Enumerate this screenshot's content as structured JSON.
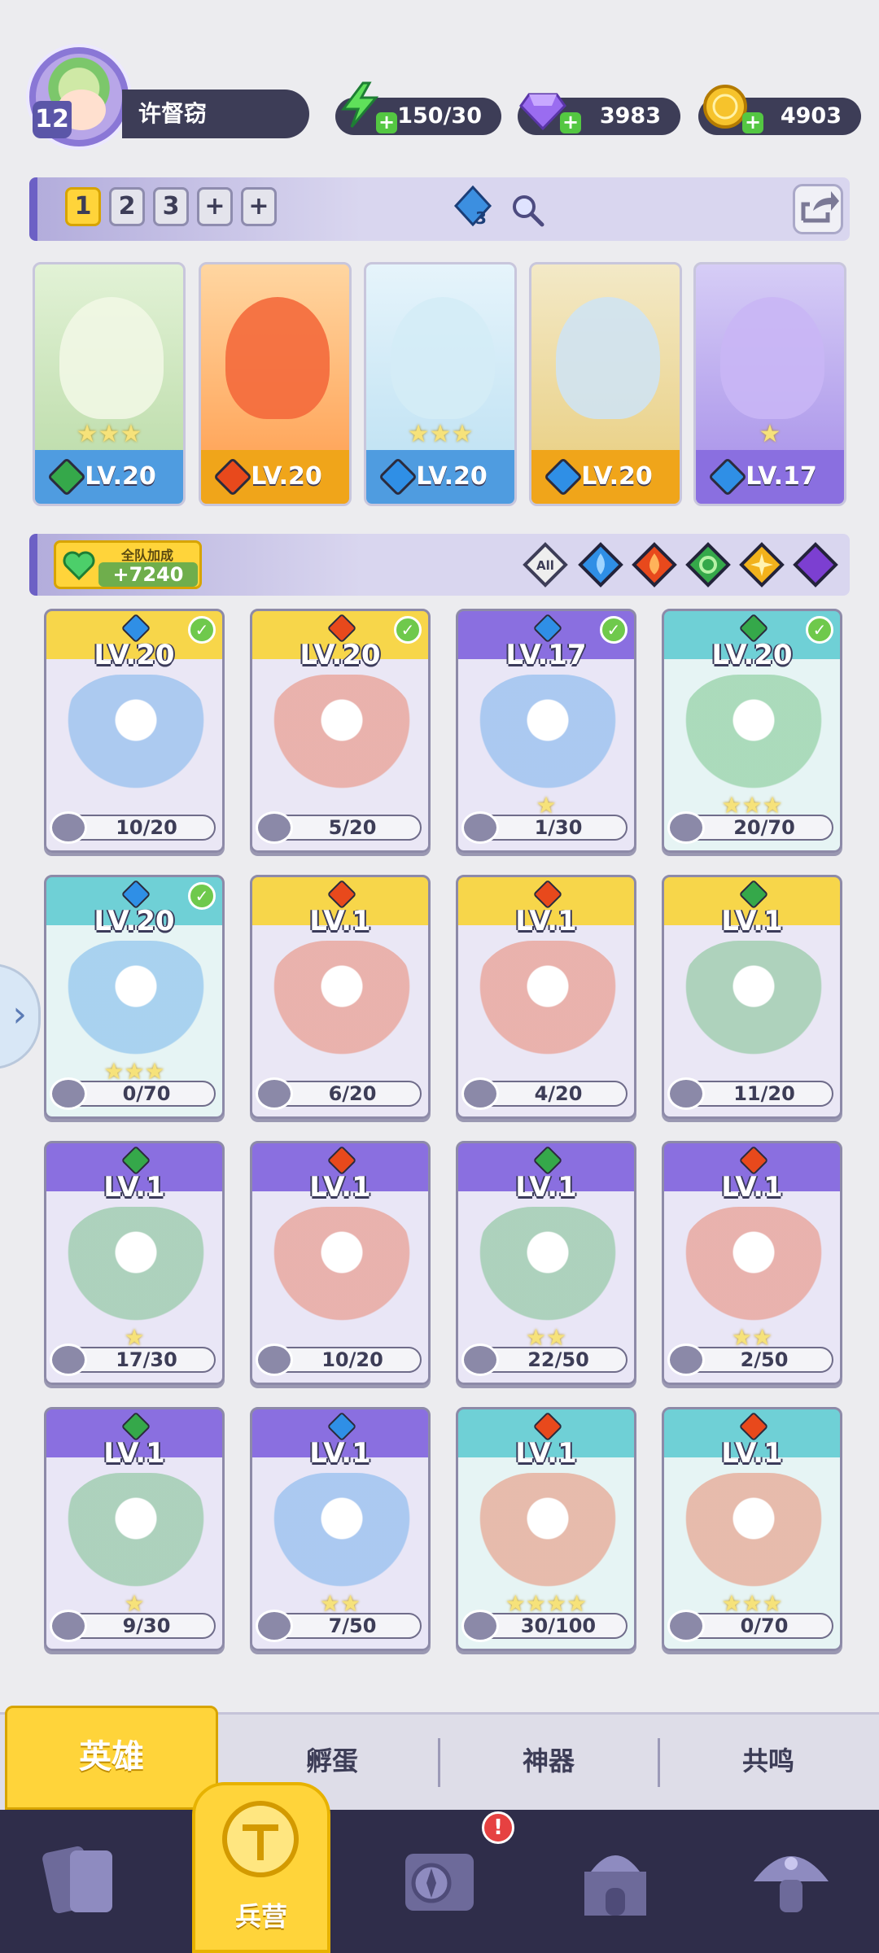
{
  "player": {
    "level": "12",
    "name": "许督窃"
  },
  "resources": [
    {
      "name": "energy",
      "value": "150/30",
      "icon": "lightning-icon"
    },
    {
      "name": "gems",
      "value": "3983",
      "icon": "diamond-icon"
    },
    {
      "name": "coins",
      "value": "4903",
      "icon": "coin-icon"
    }
  ],
  "team_slots": [
    "1",
    "2",
    "3",
    "+",
    "+"
  ],
  "team_gem_count": "3",
  "team": [
    {
      "level": "LV.20",
      "element": "nature",
      "stars": "★★★"
    },
    {
      "level": "LV.20",
      "element": "fire",
      "stars": ""
    },
    {
      "level": "LV.20",
      "element": "water",
      "stars": "★★★"
    },
    {
      "level": "LV.20",
      "element": "water",
      "stars": ""
    },
    {
      "level": "LV.17",
      "element": "water",
      "stars": "★"
    }
  ],
  "bonus": {
    "label": "全队加成",
    "value": "+7240"
  },
  "filters": [
    "All",
    "water",
    "fire",
    "nature",
    "light",
    "dark"
  ],
  "heroes": [
    {
      "level": "LV.20",
      "element": "water",
      "progress": "10/20",
      "stars": "",
      "owned": true,
      "bg": "gold"
    },
    {
      "level": "LV.20",
      "element": "fire",
      "progress": "5/20",
      "stars": "",
      "owned": true,
      "bg": "gold"
    },
    {
      "level": "LV.17",
      "element": "water",
      "progress": "1/30",
      "stars": "★",
      "owned": true,
      "bg": "purple"
    },
    {
      "level": "LV.20",
      "element": "nature",
      "progress": "20/70",
      "stars": "★★★",
      "owned": true,
      "bg": "teal"
    },
    {
      "level": "LV.20",
      "element": "water",
      "progress": "0/70",
      "stars": "★★★",
      "owned": true,
      "bg": "teal"
    },
    {
      "level": "LV.1",
      "element": "fire",
      "progress": "6/20",
      "stars": "",
      "owned": false,
      "bg": "gold"
    },
    {
      "level": "LV.1",
      "element": "fire",
      "progress": "4/20",
      "stars": "",
      "owned": false,
      "bg": "gold"
    },
    {
      "level": "LV.1",
      "element": "nature",
      "progress": "11/20",
      "stars": "",
      "owned": false,
      "bg": "gold"
    },
    {
      "level": "LV.1",
      "element": "nature",
      "progress": "17/30",
      "stars": "★",
      "owned": false,
      "bg": "purple"
    },
    {
      "level": "LV.1",
      "element": "fire",
      "progress": "10/20",
      "stars": "",
      "owned": false,
      "bg": "purple"
    },
    {
      "level": "LV.1",
      "element": "nature",
      "progress": "22/50",
      "stars": "★★",
      "owned": false,
      "bg": "purple"
    },
    {
      "level": "LV.1",
      "element": "fire",
      "progress": "2/50",
      "stars": "★★",
      "owned": false,
      "bg": "purple"
    },
    {
      "level": "LV.1",
      "element": "nature",
      "progress": "9/30",
      "stars": "★",
      "owned": false,
      "bg": "purple"
    },
    {
      "level": "LV.1",
      "element": "water",
      "progress": "7/50",
      "stars": "★★",
      "owned": false,
      "bg": "purple"
    },
    {
      "level": "LV.1",
      "element": "fire",
      "progress": "30/100",
      "stars": "★★★★",
      "owned": false,
      "bg": "teal"
    },
    {
      "level": "LV.1",
      "element": "fire",
      "progress": "0/70",
      "stars": "★★★",
      "owned": false,
      "bg": "teal"
    }
  ],
  "tabs": {
    "heroes": "英雄",
    "hatch": "孵蛋",
    "artifacts": "神器",
    "resonance": "共鸣"
  },
  "nav": {
    "barracks": "兵营",
    "alert": "!"
  },
  "colors": {
    "water": "#2f8fe6",
    "fire": "#e8491c",
    "nature": "#35a84a",
    "light": "#f2b21c",
    "dark": "#7c3fd1",
    "gold": "#f7d64a",
    "purple": "#8a6fe0",
    "teal": "#6fd0d6"
  }
}
